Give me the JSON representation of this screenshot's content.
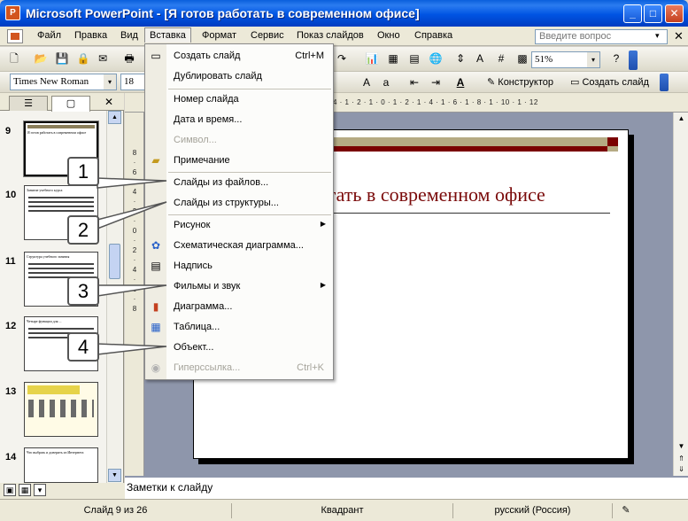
{
  "window": {
    "title": "Microsoft PowerPoint - [Я готов работать в современном офисе]",
    "app_icon": "P",
    "min_label": "_",
    "max_label": "□",
    "close_label": "✕"
  },
  "menubar": {
    "items": [
      "Файл",
      "Правка",
      "Вид",
      "Вставка",
      "Формат",
      "Сервис",
      "Показ слайдов",
      "Окно",
      "Справка"
    ],
    "active": "Вставка",
    "help_placeholder": "Введите вопрос",
    "help_arrow": "▾",
    "doc_close": "✕"
  },
  "toolbar": {
    "zoom": "51%",
    "font_name": "Times New Roman",
    "font_size": "18",
    "designer_label": "Конструктор",
    "new_slide_label": "Создать слайд",
    "dropdown_arrow": "▾"
  },
  "insert_menu": {
    "items": [
      {
        "label": "Создать слайд",
        "shortcut": "Ctrl+M",
        "icon": "new-slide-icon",
        "disabled": false,
        "submenu": false
      },
      {
        "label": "Дублировать слайд",
        "shortcut": "",
        "icon": "",
        "disabled": false,
        "submenu": false
      },
      {
        "label": "Номер слайда",
        "shortcut": "",
        "icon": "",
        "disabled": false,
        "submenu": false
      },
      {
        "label": "Дата и время...",
        "shortcut": "",
        "icon": "",
        "disabled": false,
        "submenu": false
      },
      {
        "label": "Символ...",
        "shortcut": "",
        "icon": "",
        "disabled": true,
        "submenu": false
      },
      {
        "label": "Примечание",
        "shortcut": "",
        "icon": "comment-icon",
        "disabled": false,
        "submenu": false
      },
      {
        "label": "Слайды из файлов...",
        "shortcut": "",
        "icon": "",
        "disabled": false,
        "submenu": false
      },
      {
        "label": "Слайды из структуры...",
        "shortcut": "",
        "icon": "",
        "disabled": false,
        "submenu": false
      },
      {
        "label": "Рисунок",
        "shortcut": "",
        "icon": "",
        "disabled": false,
        "submenu": true
      },
      {
        "label": "Схематическая диаграмма...",
        "shortcut": "",
        "icon": "diagram-icon",
        "disabled": false,
        "submenu": false
      },
      {
        "label": "Надпись",
        "shortcut": "",
        "icon": "textbox-icon",
        "disabled": false,
        "submenu": false
      },
      {
        "label": "Фильмы и звук",
        "shortcut": "",
        "icon": "",
        "disabled": false,
        "submenu": true
      },
      {
        "label": "Диаграмма...",
        "shortcut": "",
        "icon": "chart-icon",
        "disabled": false,
        "submenu": false
      },
      {
        "label": "Таблица...",
        "shortcut": "",
        "icon": "table-icon",
        "disabled": false,
        "submenu": false
      },
      {
        "label": "Объект...",
        "shortcut": "",
        "icon": "",
        "disabled": false,
        "submenu": false
      },
      {
        "label": "Гиперссылка...",
        "shortcut": "Ctrl+K",
        "icon": "hyperlink-icon",
        "disabled": true,
        "submenu": false
      }
    ]
  },
  "slide_panel": {
    "slides": [
      {
        "number": "9",
        "thumb_text": "Я готов работать в современном офисе"
      },
      {
        "number": "10",
        "thumb_text": "Занятие учебного курса"
      },
      {
        "number": "11",
        "thumb_text": "Структура учебного занятия"
      },
      {
        "number": "12",
        "thumb_text": "Четыре функции для ..."
      },
      {
        "number": "13",
        "thumb_text": ""
      },
      {
        "number": "14",
        "thumb_text": "Что выбрать и доверить из Интернета"
      }
    ],
    "close_label": "✕"
  },
  "ruler": {
    "horizontal": "4 · 1 · 2 · 1 · 0 · 1 · 2 · 1 · 4 · 1 · 6 · 1 · 8 · 1 · 10 · 1 · 12",
    "vertical": "8 · 6 · 4 · 2 · 0 · 2 · 4 · 6 · 8"
  },
  "slide": {
    "title_visible": "отать в современном офисе"
  },
  "notes": {
    "placeholder": "Заметки к слайду"
  },
  "statusbar": {
    "slide_info": "Слайд 9 из 26",
    "design": "Квадрант",
    "language": "русский (Россия)"
  },
  "callouts": [
    "1",
    "2",
    "3",
    "4"
  ],
  "colors": {
    "title_bar": "#0054e3",
    "slide_title": "#7a0a0a",
    "accent_dark_red": "#7a0000",
    "accent_khaki": "#b5aa83",
    "workspace": "#8e96ab"
  }
}
